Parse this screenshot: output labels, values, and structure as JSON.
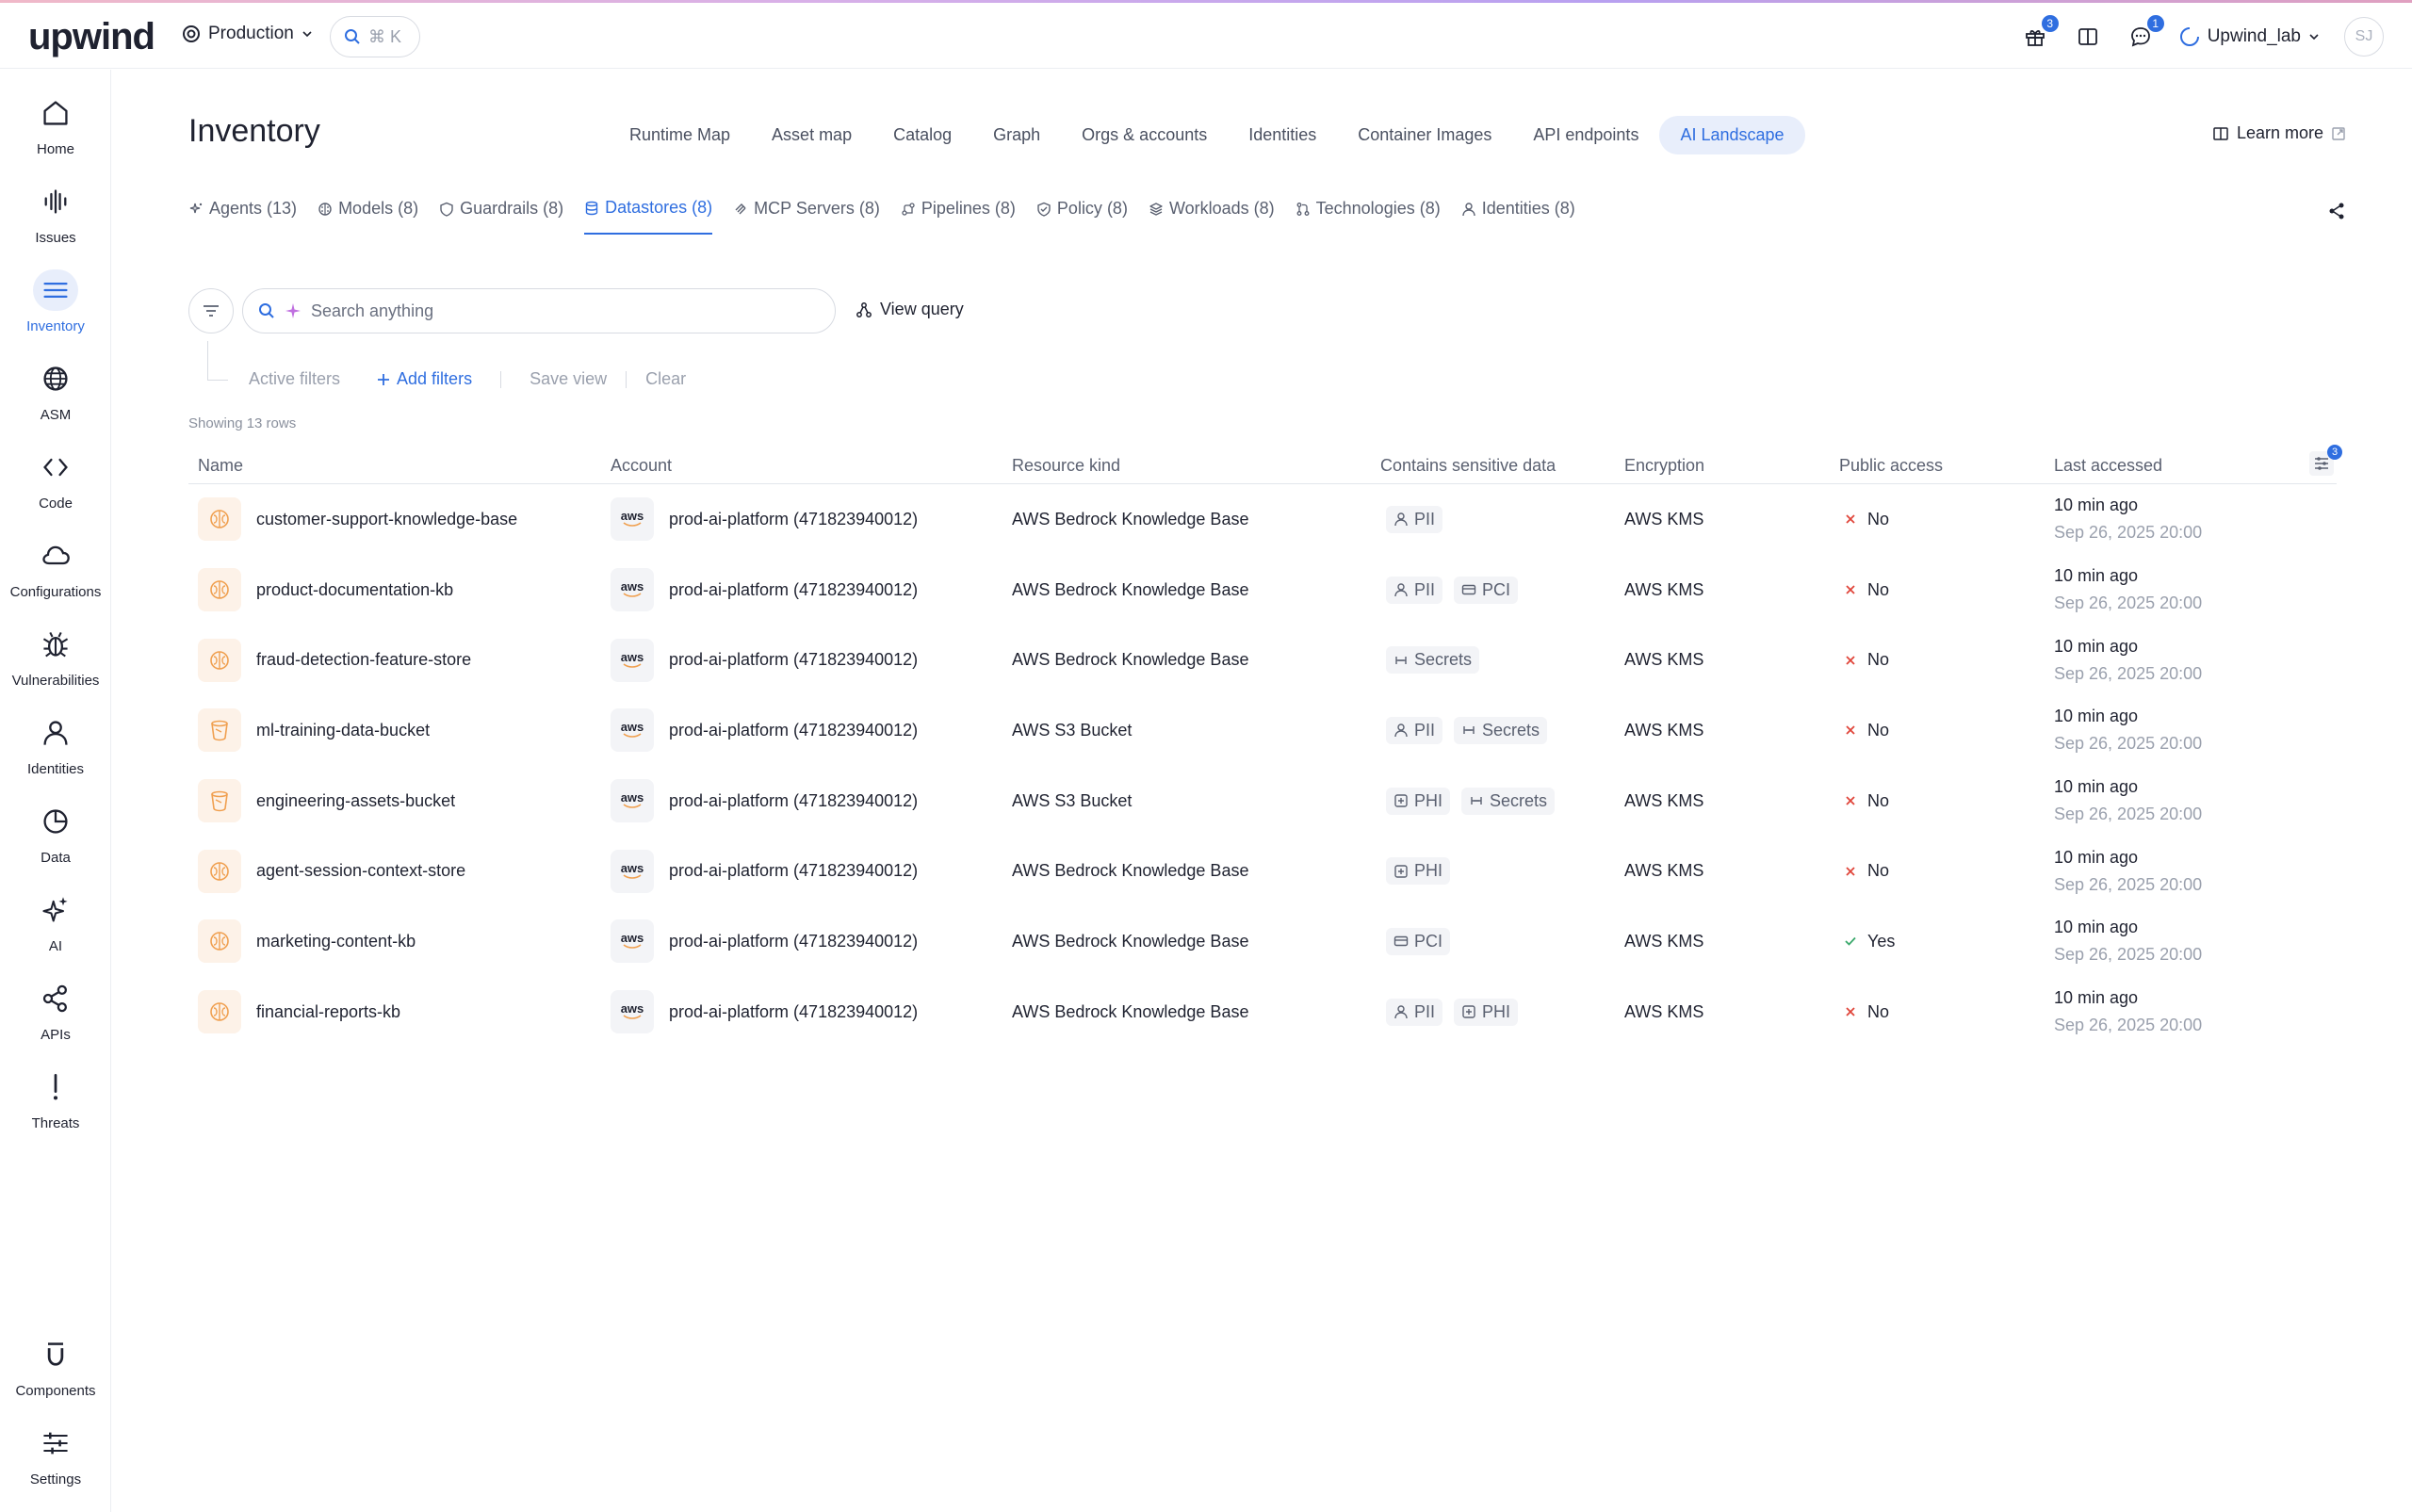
{
  "brand": {
    "logo_text": "upwind"
  },
  "header": {
    "environment": "Production",
    "search_shortcut": "⌘ K",
    "gift_badge": "3",
    "messages_badge": "1",
    "org_name": "Upwind_lab",
    "avatar_initials": "SJ"
  },
  "sidebar": {
    "items": [
      {
        "label": "Home",
        "icon": "home-icon"
      },
      {
        "label": "Issues",
        "icon": "issues-icon"
      },
      {
        "label": "Inventory",
        "icon": "inventory-icon"
      },
      {
        "label": "ASM",
        "icon": "globe-icon"
      },
      {
        "label": "Code",
        "icon": "code-icon"
      },
      {
        "label": "Configurations",
        "icon": "cloud-icon"
      },
      {
        "label": "Vulnerabilities",
        "icon": "bug-icon"
      },
      {
        "label": "Identities",
        "icon": "user-icon"
      },
      {
        "label": "Data",
        "icon": "pie-chart-icon"
      },
      {
        "label": "AI",
        "icon": "sparkles-icon"
      },
      {
        "label": "APIs",
        "icon": "share-nodes-icon"
      },
      {
        "label": "Threats",
        "icon": "exclamation-icon"
      }
    ],
    "bottom_items": [
      {
        "label": "Components",
        "icon": "components-icon"
      },
      {
        "label": "Settings",
        "icon": "sliders-icon"
      }
    ],
    "active_index": 2
  },
  "page": {
    "title": "Inventory",
    "tabs": [
      "Runtime Map",
      "Asset map",
      "Catalog",
      "Graph",
      "Orgs & accounts",
      "Identities",
      "Container Images",
      "API endpoints",
      "AI Landscape"
    ],
    "active_tab": "AI Landscape",
    "learn_more": "Learn more",
    "subtabs": [
      {
        "label": "Agents (13)",
        "icon": "sparkle-icon"
      },
      {
        "label": "Models (8)",
        "icon": "brain-icon"
      },
      {
        "label": "Guardrails (8)",
        "icon": "shield-icon"
      },
      {
        "label": "Datastores (8)",
        "icon": "database-icon"
      },
      {
        "label": "MCP Servers (8)",
        "icon": "mcp-icon"
      },
      {
        "label": "Pipelines (8)",
        "icon": "pipeline-icon"
      },
      {
        "label": "Policy (8)",
        "icon": "shield-check-icon"
      },
      {
        "label": "Workloads (8)",
        "icon": "layers-icon"
      },
      {
        "label": "Technologies (8)",
        "icon": "git-icon"
      },
      {
        "label": "Identities (8)",
        "icon": "user-icon"
      }
    ],
    "active_subtab": "Datastores (8)"
  },
  "toolbar": {
    "search_placeholder": "Search anything",
    "view_query": "View query",
    "active_filters": "Active filters",
    "add_filters": "Add filters",
    "save_view": "Save view",
    "clear": "Clear",
    "showing": "Showing 13 rows",
    "columns_badge": "3"
  },
  "table": {
    "columns": [
      "Name",
      "Account",
      "Resource kind",
      "Contains sensitive data",
      "Encryption",
      "Public access",
      "Last accessed"
    ],
    "rows": [
      {
        "name": "customer-support-knowledge-base",
        "kind_icon": "brain-icon",
        "account": "prod-ai-platform (471823940012)",
        "resource": "AWS Bedrock Knowledge Base",
        "sensitive": [
          {
            "label": "PII",
            "icon": "user-icon"
          }
        ],
        "encryption": "AWS KMS",
        "public": "No",
        "public_ok": false,
        "ago": "10 min ago",
        "date": "Sep 26, 2025 20:00"
      },
      {
        "name": "product-documentation-kb",
        "kind_icon": "brain-icon",
        "account": "prod-ai-platform (471823940012)",
        "resource": "AWS Bedrock Knowledge Base",
        "sensitive": [
          {
            "label": "PII",
            "icon": "user-icon"
          },
          {
            "label": "PCI",
            "icon": "card-icon"
          }
        ],
        "encryption": "AWS KMS",
        "public": "No",
        "public_ok": false,
        "ago": "10 min ago",
        "date": "Sep 26, 2025 20:00"
      },
      {
        "name": "fraud-detection-feature-store",
        "kind_icon": "brain-icon",
        "account": "prod-ai-platform (471823940012)",
        "resource": "AWS Bedrock Knowledge Base",
        "sensitive": [
          {
            "label": "Secrets",
            "icon": "secret-icon"
          }
        ],
        "encryption": "AWS KMS",
        "public": "No",
        "public_ok": false,
        "ago": "10 min ago",
        "date": "Sep 26, 2025 20:00"
      },
      {
        "name": "ml-training-data-bucket",
        "kind_icon": "bucket-icon",
        "account": "prod-ai-platform (471823940012)",
        "resource": "AWS S3 Bucket",
        "sensitive": [
          {
            "label": "PII",
            "icon": "user-icon"
          },
          {
            "label": "Secrets",
            "icon": "secret-icon"
          }
        ],
        "encryption": "AWS KMS",
        "public": "No",
        "public_ok": false,
        "ago": "10 min ago",
        "date": "Sep 26, 2025 20:00"
      },
      {
        "name": "engineering-assets-bucket",
        "kind_icon": "bucket-icon",
        "account": "prod-ai-platform (471823940012)",
        "resource": "AWS S3 Bucket",
        "sensitive": [
          {
            "label": "PHI",
            "icon": "plus-square-icon"
          },
          {
            "label": "Secrets",
            "icon": "secret-icon"
          }
        ],
        "encryption": "AWS KMS",
        "public": "No",
        "public_ok": false,
        "ago": "10 min ago",
        "date": "Sep 26, 2025 20:00"
      },
      {
        "name": "agent-session-context-store",
        "kind_icon": "brain-icon",
        "account": "prod-ai-platform (471823940012)",
        "resource": "AWS Bedrock Knowledge Base",
        "sensitive": [
          {
            "label": "PHI",
            "icon": "plus-square-icon"
          }
        ],
        "encryption": "AWS KMS",
        "public": "No",
        "public_ok": false,
        "ago": "10 min ago",
        "date": "Sep 26, 2025 20:00"
      },
      {
        "name": "marketing-content-kb",
        "kind_icon": "brain-icon",
        "account": "prod-ai-platform (471823940012)",
        "resource": "AWS Bedrock Knowledge Base",
        "sensitive": [
          {
            "label": "PCI",
            "icon": "card-icon"
          }
        ],
        "encryption": "AWS KMS",
        "public": "Yes",
        "public_ok": true,
        "ago": "10 min ago",
        "date": "Sep 26, 2025 20:00"
      },
      {
        "name": "financial-reports-kb",
        "kind_icon": "brain-icon",
        "account": "prod-ai-platform (471823940012)",
        "resource": "AWS Bedrock Knowledge Base",
        "sensitive": [
          {
            "label": "PII",
            "icon": "user-icon"
          },
          {
            "label": "PHI",
            "icon": "plus-square-icon"
          }
        ],
        "encryption": "AWS KMS",
        "public": "No",
        "public_ok": false,
        "ago": "10 min ago",
        "date": "Sep 26, 2025 20:00"
      }
    ],
    "aws_label": "aws"
  },
  "colors": {
    "accent": "#2f6ee0",
    "accent_bg": "#e8eefb",
    "orange": "#f0a050",
    "red": "#e0453a",
    "green": "#3aa86b"
  }
}
